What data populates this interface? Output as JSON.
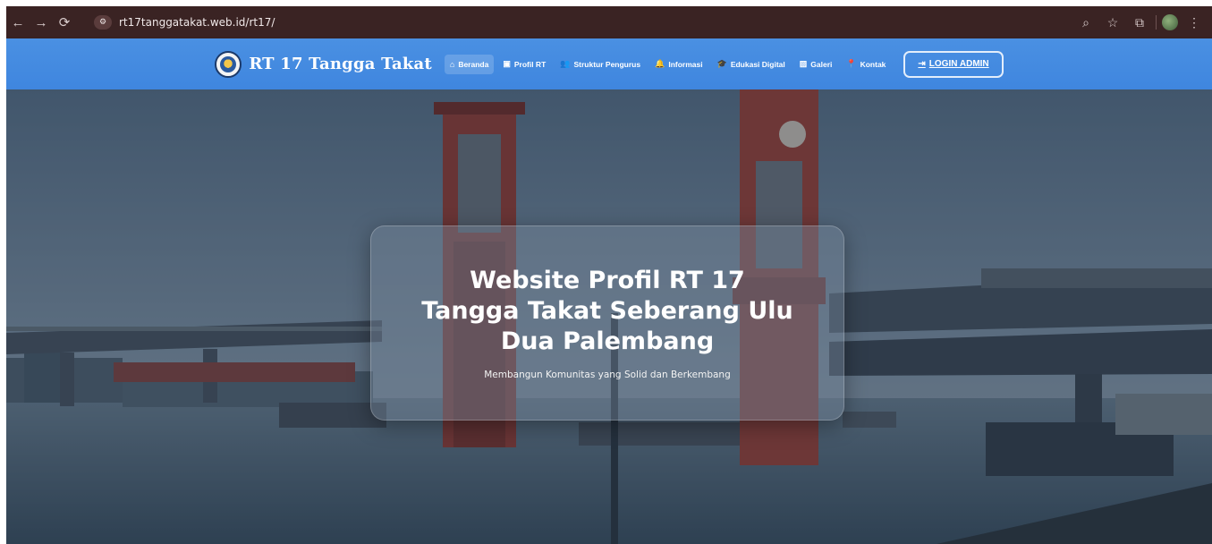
{
  "browser": {
    "url": "rt17tanggatakat.web.id/rt17/",
    "icons": [
      "back-icon",
      "forward-icon",
      "reload-icon",
      "site-info-icon",
      "zoom-icon",
      "star-icon",
      "extensions-icon",
      "profile-avatar",
      "menu-icon"
    ]
  },
  "header": {
    "brand": "RT 17 Tangga Takat",
    "nav": [
      {
        "label": "Beranda",
        "icon": "home-icon",
        "glyph": "⌂"
      },
      {
        "label": "Profil RT",
        "icon": "id-card-icon",
        "glyph": "▣"
      },
      {
        "label": "Struktur Pengurus",
        "icon": "users-icon",
        "glyph": "👥"
      },
      {
        "label": "Informasi",
        "icon": "bell-icon",
        "glyph": "🔔"
      },
      {
        "label": "Edukasi Digital",
        "icon": "graduation-cap-icon",
        "glyph": "🎓"
      },
      {
        "label": "Galeri",
        "icon": "images-icon",
        "glyph": "▨"
      },
      {
        "label": "Kontak",
        "icon": "map-pin-icon",
        "glyph": "📍"
      }
    ],
    "login": "LOGIN ADMIN"
  },
  "hero": {
    "title": "Website Profil RT 17 Tangga Takat Seberang Ulu Dua Palembang",
    "subtitle": "Membangun Komunitas yang Solid dan Berkembang"
  },
  "colors": {
    "header_blue": "#4a90e2",
    "chrome": "#3a2323",
    "tower_red": "#b0473c"
  }
}
